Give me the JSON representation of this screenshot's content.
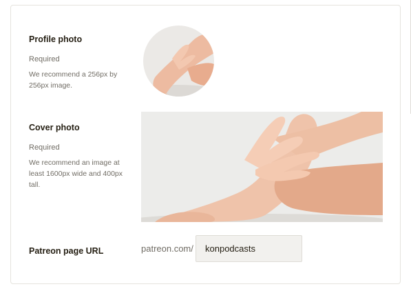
{
  "profile": {
    "title": "Profile photo",
    "required": "Required",
    "help": "We recommend a 256px by 256px image."
  },
  "cover": {
    "title": "Cover photo",
    "required": "Required",
    "help": "We recommend an image at least 1600px wide and 400px tall."
  },
  "url": {
    "title": "Patreon page URL",
    "prefix": "patreon.com/",
    "value": "konpodcasts"
  }
}
